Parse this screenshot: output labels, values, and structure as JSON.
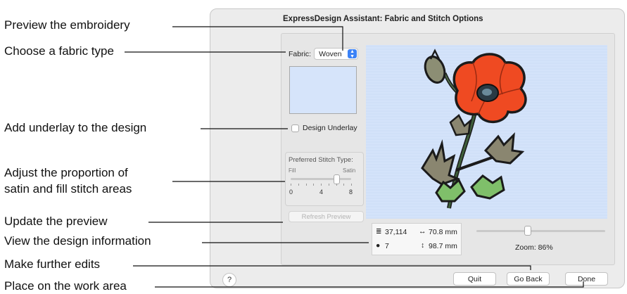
{
  "callouts": {
    "preview": "Preview the embroidery",
    "fabric": "Choose a fabric type",
    "underlay": "Add underlay to the design",
    "proportion_line1": "Adjust the proportion of",
    "proportion_line2": "satin and fill stitch areas",
    "update": "Update the preview",
    "info": "View the design information",
    "edits": "Make further edits",
    "place": "Place on the work area"
  },
  "dialog": {
    "title": "ExpressDesign Assistant: Fabric and Stitch Options",
    "fabric_label": "Fabric:",
    "fabric_value": "Woven",
    "design_underlay_label": "Design Underlay",
    "design_underlay_checked": false,
    "stitch_type": {
      "title": "Preferred Stitch Type:",
      "min_label": "Fill",
      "max_label": "Satin",
      "ticks": [
        "0",
        "4",
        "8"
      ],
      "value": 6
    },
    "refresh_label": "Refresh Preview",
    "info": {
      "stitch_count": "37,114",
      "width": "70.8 mm",
      "colors": "7",
      "height": "98.7 mm"
    },
    "zoom_label": "Zoom: 86%",
    "help_label": "?",
    "buttons": {
      "quit": "Quit",
      "go_back": "Go Back",
      "done": "Done"
    }
  },
  "colors": {
    "preview_bg": "#d4e3fa",
    "petal": "#ef4a22",
    "leaf_green": "#7fbf6a",
    "leaf_gray": "#8a8670",
    "outline": "#1b1b1b",
    "accent": "#3b82f6"
  },
  "icons": {
    "stitch_count": "stitch-lines-icon",
    "colors": "palette-icon",
    "width": "horizontal-arrow-icon",
    "height": "vertical-arrow-icon",
    "select_arrow": "stepper-arrows-icon"
  }
}
